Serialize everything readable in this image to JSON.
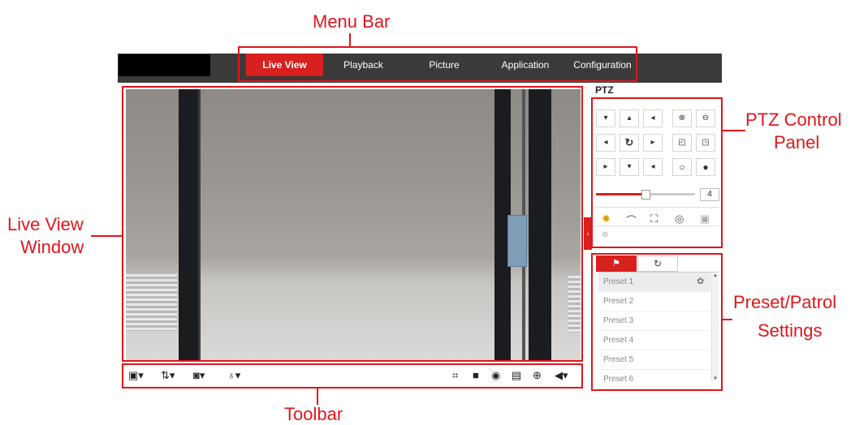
{
  "menu": {
    "items": [
      "Live View",
      "Playback",
      "Picture",
      "Application",
      "Configuration"
    ],
    "active_color": "#d8201f",
    "bar_color": "#3a3a3a"
  },
  "ptz": {
    "title": "PTZ",
    "speed_value": "4",
    "speed_level_fraction": 0.5
  },
  "presets": {
    "items": [
      "Preset 1",
      "Preset 2",
      "Preset 3",
      "Preset 4",
      "Preset 5",
      "Preset 6"
    ],
    "tabs": [
      "flag-icon",
      "refresh-icon"
    ]
  },
  "callouts": {
    "menu_bar": "Menu Bar",
    "ptz_line1": "PTZ Control",
    "ptz_line2": "Panel",
    "live_line1": "Live View",
    "live_line2": "Window",
    "preset_line1": "Preset/Patrol",
    "preset_line2": "Settings",
    "toolbar": "Toolbar"
  },
  "annotation_color": "#e0161c"
}
